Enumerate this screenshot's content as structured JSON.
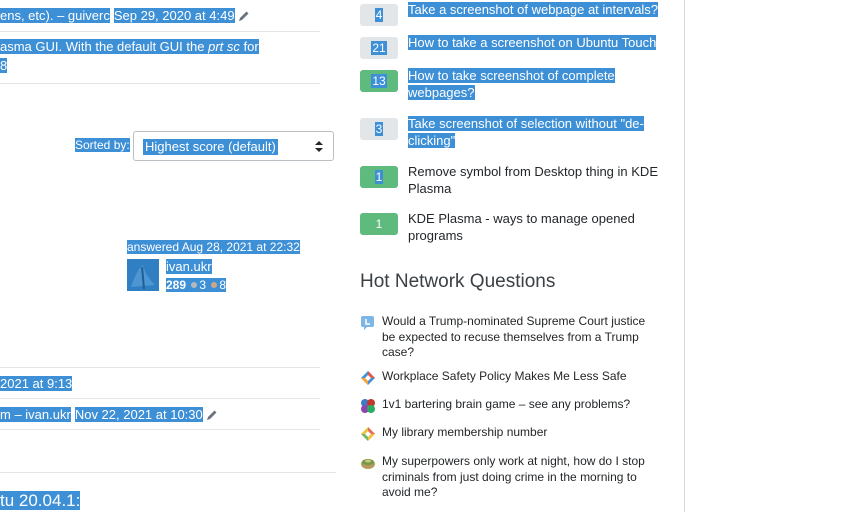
{
  "comments": {
    "c1": {
      "text_a": "ens, etc). – ",
      "user": "guiverc",
      "date": "Sep 29, 2020 at 4:49"
    },
    "c2": {
      "text_a": "asma GUI. With the default GUI the ",
      "em": "prt sc",
      "text_b": " for",
      "line2": "8"
    }
  },
  "sort": {
    "label": "Sorted by:",
    "value": "Highest score (default)"
  },
  "answer": {
    "answered": "answered Aug 28, 2021 at 22:32",
    "user": "ivan.ukr",
    "rep": "289",
    "silver": "3",
    "bronze": "8"
  },
  "answer_comments": {
    "c1": {
      "date_frag": "2021 at 9:13"
    },
    "c2": {
      "text_a": "m – ",
      "user": "ivan.ukr",
      "date": "Nov 22, 2021 at 10:30"
    }
  },
  "heading_fragment": "tu 20.04.1:",
  "linked": [
    {
      "score": "4",
      "title": "Take a screenshot of webpage at intervals?",
      "accepted": false
    },
    {
      "score": "21",
      "title": "How to take a screenshot on Ubuntu Touch",
      "accepted": false
    },
    {
      "score": "13",
      "title": "How to take screenshot of complete webpages?",
      "accepted": true
    },
    {
      "score": "3",
      "title": "Take screenshot of selection without \"de-clicking\"",
      "accepted": false
    },
    {
      "score": "1",
      "title": "Remove symbol from Desktop thing in KDE Plasma",
      "accepted": true
    },
    {
      "score": "1",
      "title": "KDE Plasma - ways to manage opened programs",
      "accepted": true
    }
  ],
  "hnq": {
    "title": "Hot Network Questions",
    "items": [
      {
        "icon": "law-site-icon",
        "text": "Would a Trump-nominated Supreme Court justice be expected to recuse themselves from a Trump case?"
      },
      {
        "icon": "workplace-site-icon",
        "text": "Workplace Safety Policy Makes Me Less Safe"
      },
      {
        "icon": "puzzling-site-icon",
        "text": "1v1 bartering brain game – see any problems?"
      },
      {
        "icon": "english-site-icon",
        "text": "My library membership number"
      },
      {
        "icon": "worldbuilding-site-icon",
        "text": "My superpowers only work at night, how do I stop criminals from just doing crime in the morning to avoid me?"
      }
    ]
  },
  "colors": {
    "selection": "#3d8fd6",
    "accepted_green": "#5eba7d",
    "score_gray": "#e3e6e8",
    "divider": "#e3e6e8"
  }
}
